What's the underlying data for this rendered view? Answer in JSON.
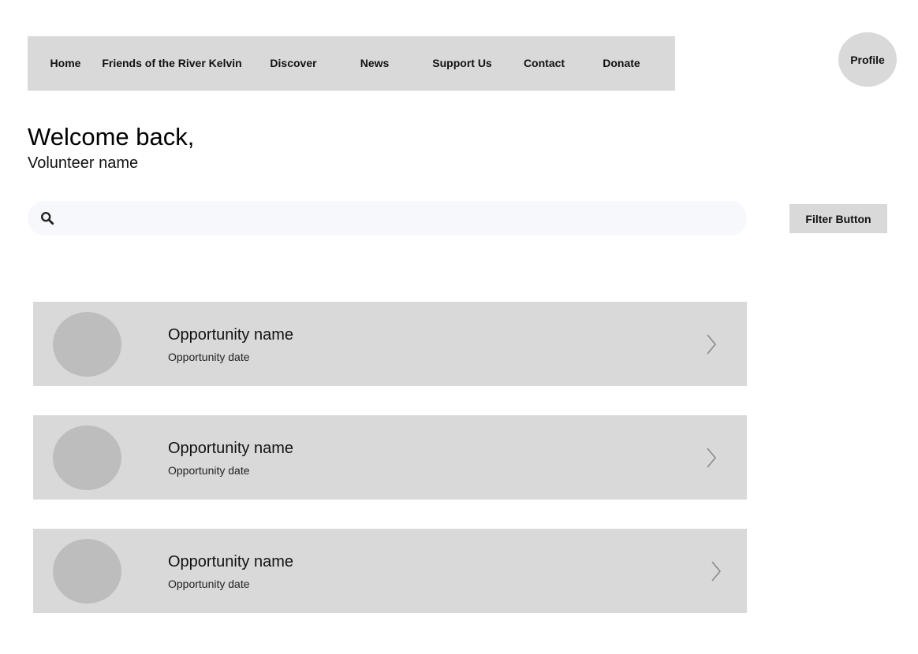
{
  "nav": {
    "items": [
      {
        "label": "Home"
      },
      {
        "label": "Friends of the River Kelvin"
      },
      {
        "label": "Discover"
      },
      {
        "label": "News"
      },
      {
        "label": "Support Us"
      },
      {
        "label": "Contact"
      },
      {
        "label": "Donate"
      }
    ]
  },
  "profile": {
    "label": "Profile"
  },
  "welcome": {
    "heading": "Welcome back,",
    "name": "Volunteer name"
  },
  "search": {
    "value": "",
    "placeholder": "",
    "icon": "search-icon"
  },
  "filter": {
    "label": "Filter Button"
  },
  "opportunities": [
    {
      "name": "Opportunity name",
      "date": "Opportunity date"
    },
    {
      "name": "Opportunity name",
      "date": "Opportunity date"
    },
    {
      "name": "Opportunity name",
      "date": "Opportunity date"
    }
  ],
  "colors": {
    "panel": "#d9d9d9",
    "thumb": "#bdbdbd",
    "search_bg": "#f7f8fc",
    "chevron": "#8a8a8a"
  }
}
